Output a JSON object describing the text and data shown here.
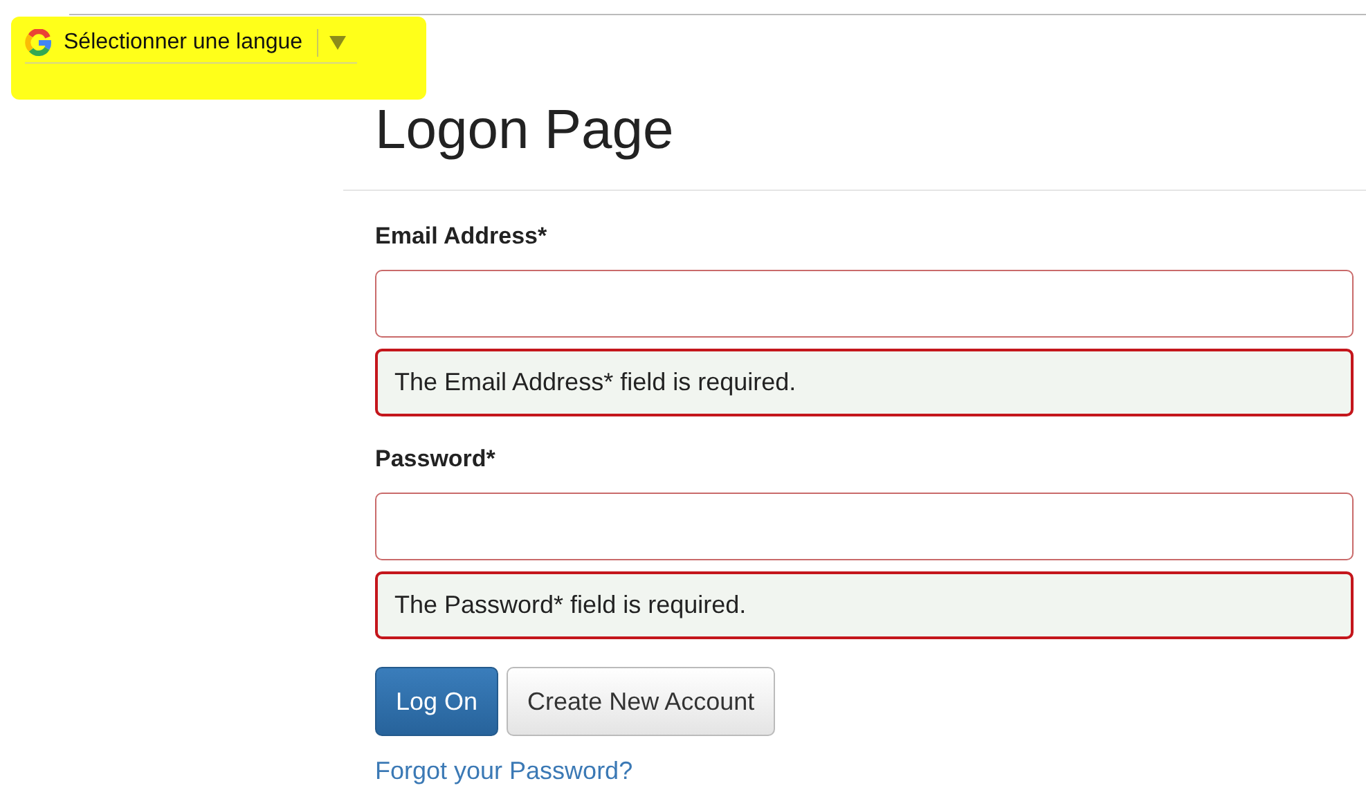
{
  "language_selector": {
    "label": "Sélectionner une langue",
    "highlighted": true
  },
  "title": "Logon Page",
  "fields": [
    {
      "label": "Email Address*",
      "invalid": true,
      "error": "The Email Address* field is required."
    },
    {
      "label": "Password*",
      "invalid": true,
      "error": "The Password* field is required."
    }
  ],
  "buttons": [
    {
      "label": "Log On",
      "kind": "primary"
    },
    {
      "label": "Create New Account",
      "kind": "default"
    }
  ],
  "link": "Forgot your Password?"
}
